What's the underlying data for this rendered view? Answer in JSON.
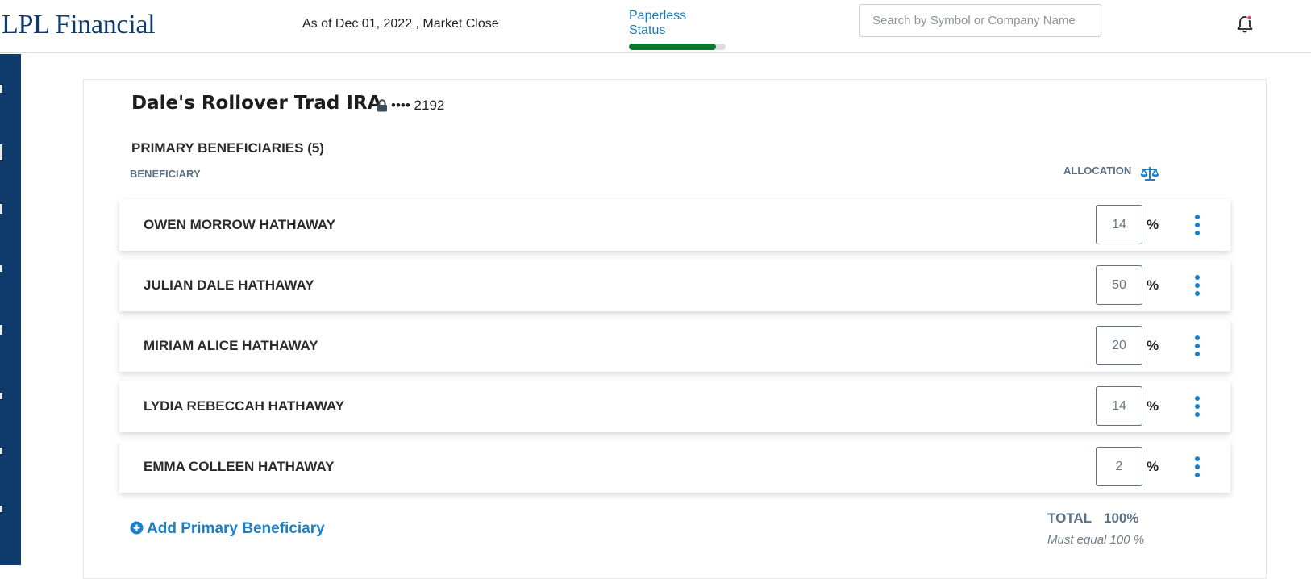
{
  "header": {
    "logo": "LPL Financial",
    "as_of": "As of Dec 01, 2022 , Market Close",
    "paperless_label": "Paperless Status",
    "paperless_progress": 0.9,
    "search_placeholder": "Search by Symbol or Company Name",
    "notification_icon": "bell-icon"
  },
  "account": {
    "name": "Dale's Rollover Trad IRA",
    "number_masked": "•••• 2192",
    "lock_icon": "lock-icon"
  },
  "primary_beneficiaries": {
    "title": "PRIMARY BENEFICIARIES (5)",
    "col_beneficiary": "BENEFICIARY",
    "col_allocation": "ALLOCATION",
    "allocation_icon": "balance-scale-icon",
    "percent_symbol": "%",
    "rows": [
      {
        "name": "OWEN MORROW HATHAWAY",
        "allocation": "14"
      },
      {
        "name": "JULIAN DALE HATHAWAY",
        "allocation": "50"
      },
      {
        "name": "MIRIAM ALICE HATHAWAY",
        "allocation": "20"
      },
      {
        "name": "LYDIA REBECCAH HATHAWAY",
        "allocation": "14"
      },
      {
        "name": "EMMA COLLEEN HATHAWAY",
        "allocation": "2"
      }
    ],
    "row_menu_icon": "kebab-menu-icon",
    "add_label": "Add Primary Beneficiary",
    "add_icon": "plus-circle-icon",
    "total_label": "TOTAL",
    "total_value": "100%",
    "total_note": "Must equal 100 %"
  },
  "colors": {
    "brand_navy": "#0e3b6b",
    "link_blue": "#1b80c4",
    "progress_green": "#0b7a2e",
    "muted_label": "#5b7289"
  }
}
